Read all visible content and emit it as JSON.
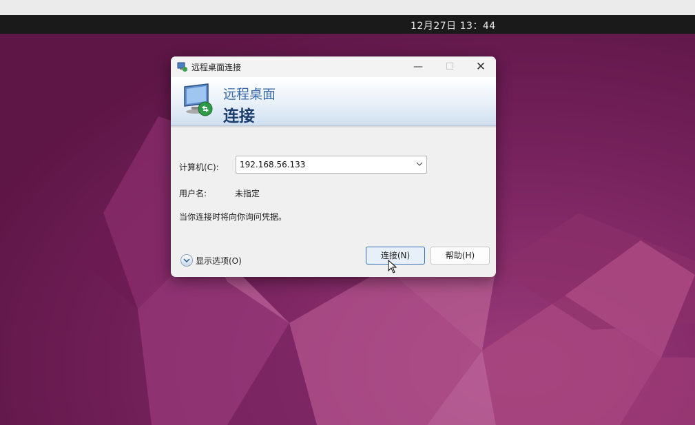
{
  "system": {
    "clock": "12月27日  13：44"
  },
  "dialog": {
    "title": "远程桌面连接",
    "banner_sub": "远程桌面",
    "banner_main": "连接",
    "computer_label": "计算机(C):",
    "computer_value": "192.168.56.133",
    "user_label": "用户名:",
    "user_value": "未指定",
    "prompt": "当你连接时将向你询问凭据。",
    "show_options": "显示选项(O)",
    "connect_button": "连接(N)",
    "help_button": "帮助(H)",
    "icons": [
      "remote-desktop-icon",
      "minimize-icon",
      "maximize-icon",
      "close-icon",
      "chevron-down-icon",
      "expand-options-icon"
    ]
  },
  "colors": {
    "desktop": "#6e1e50",
    "accent": "#2f6db5",
    "banner_text": "#1c3e6e"
  }
}
